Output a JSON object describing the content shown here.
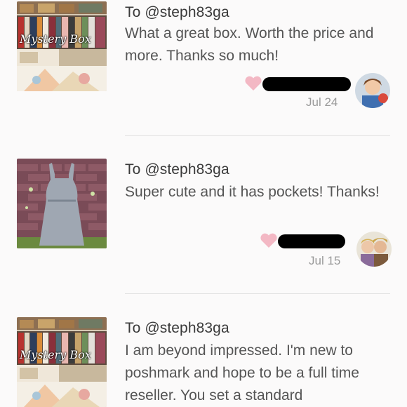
{
  "reviews": [
    {
      "to": "To @steph83ga",
      "text": "What a great box. Worth the price and more. Thanks so much!",
      "date": "Jul 24",
      "thumb_caption": "Mystery Box"
    },
    {
      "to": "To @steph83ga",
      "text": "Super cute and it has pockets! Thanks!",
      "date": "Jul 15"
    },
    {
      "to": "To @steph83ga",
      "text": "I am beyond impressed. I'm new to poshmark and hope to be a full time reseller. You set a standard",
      "thumb_caption": "Mystery Box"
    }
  ],
  "icons": {
    "heart": "heart-icon",
    "heart_color": "#f3b8c4"
  }
}
